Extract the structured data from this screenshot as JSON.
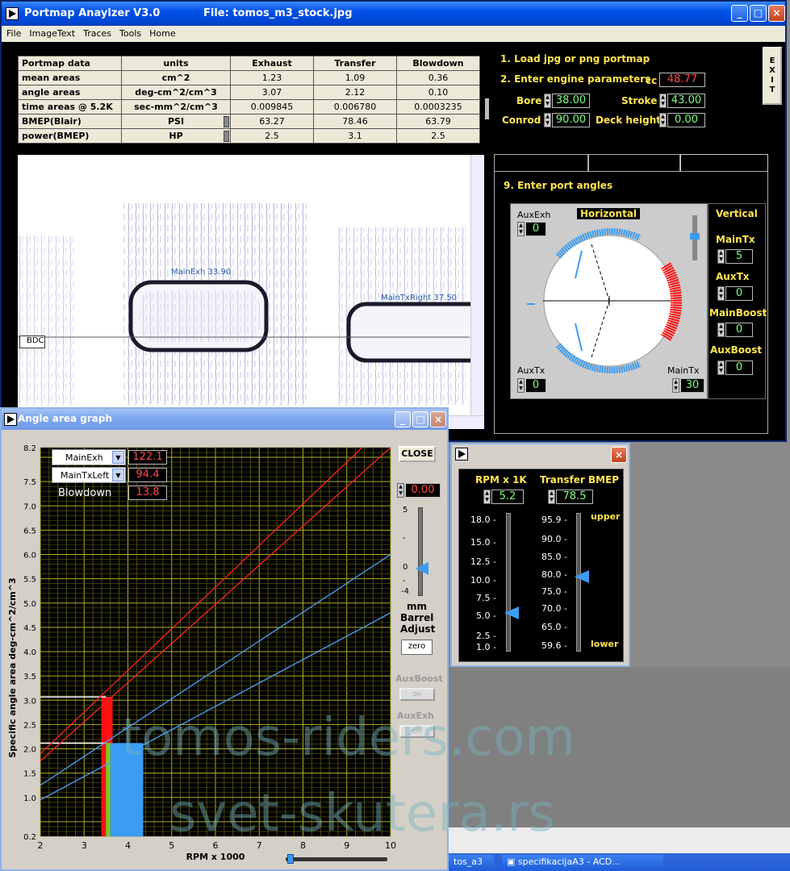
{
  "main_window": {
    "title": "Portmap Anaylzer V3.0",
    "file_label": "File: tomos_m3_stock.jpg",
    "menu": [
      "File",
      "ImageText",
      "Traces",
      "Tools",
      "Home"
    ],
    "exit_label": "EXIT"
  },
  "portmap_table": {
    "headers": [
      "Portmap data",
      "units",
      "Exhaust",
      "Transfer",
      "Blowdown"
    ],
    "rows": [
      {
        "label": "mean areas",
        "unit": "cm^2",
        "exhaust": "1.23",
        "transfer": "1.09",
        "blowdown": "0.36"
      },
      {
        "label": "angle areas",
        "unit": "deg-cm^2/cm^3",
        "exhaust": "3.07",
        "transfer": "2.12",
        "blowdown": "0.10"
      },
      {
        "label": "time areas @ 5.2K",
        "unit": "sec-mm^2/cm^3",
        "exhaust": "0.009845",
        "transfer": "0.006780",
        "blowdown": "0.0003235"
      },
      {
        "label": "BMEP(Blair)",
        "unit": "PSI",
        "exhaust": "63.27",
        "transfer": "78.46",
        "blowdown": "63.79"
      },
      {
        "label": "power(BMEP)",
        "unit": "HP",
        "exhaust": "2.5",
        "transfer": "3.1",
        "blowdown": "2.5"
      }
    ]
  },
  "portmap_image": {
    "labels": {
      "main_exh": "MainExh 33.90",
      "main_tx_right": "MainTxRight 37.50",
      "bdc": "BDC"
    }
  },
  "params": {
    "step1": "1. Load jpg or png portmap",
    "step2": "2. Enter engine parameters",
    "cc_label": "cc",
    "cc_value": "48.77",
    "bore_label": "Bore",
    "bore_value": "38.00",
    "stroke_label": "Stroke",
    "stroke_value": "43.00",
    "conrod_label": "Conrod",
    "conrod_value": "90.00",
    "deck_label": "Deck height",
    "deck_value": "0.00"
  },
  "port_angles": {
    "step9": "9. Enter port angles",
    "horizontal_label": "Horizontal",
    "vertical_label": "Vertical",
    "aux_exh_label": "AuxExh",
    "aux_exh_value": "0",
    "aux_tx_label": "AuxTx",
    "aux_tx_value": "0",
    "main_tx_label": "MainTx",
    "main_tx_value": "30",
    "v_main_tx_label": "MainTx",
    "v_main_tx_value": "5",
    "v_aux_tx_label": "AuxTx",
    "v_aux_tx_value": "0",
    "v_main_boost_label": "MainBoost",
    "v_main_boost_value": "0",
    "v_aux_boost_label": "AuxBoost",
    "v_aux_boost_value": "0"
  },
  "graph_window": {
    "title": "Angle area graph",
    "close_label": "CLOSE",
    "sel1_label": "MainExh",
    "sel1_value": "122.1",
    "sel2_label": "MainTxLeft",
    "sel2_value": "94.4",
    "blowdown_label": "Blowdown",
    "blowdown_value": "13.8",
    "barrel_value": "0.00",
    "barrel_ticks": [
      "5",
      "-",
      "0",
      "-",
      "-4"
    ],
    "barrel_label_1": "mm",
    "barrel_label_2": "Barrel",
    "barrel_label_3": "Adjust",
    "zero_label": "zero",
    "aux_boost_label": "AuxBoost",
    "aux_boost_btn": "on",
    "aux_exh_label": "AuxExh",
    "aux_exh_btn": "on"
  },
  "chart_data": {
    "type": "line",
    "xlabel": "RPM x 1000",
    "ylabel": "Specific angle area  deg-cm^2/cm^3",
    "xlim": [
      2,
      10
    ],
    "ylim": [
      0.2,
      8.2
    ],
    "x_ticks": [
      "2",
      "3",
      "4",
      "5",
      "6",
      "7",
      "8",
      "9",
      "10"
    ],
    "y_ticks": [
      "0.2",
      "1.0",
      "1.5",
      "2.0",
      "2.5",
      "3.0",
      "3.5",
      "4.0",
      "4.5",
      "5.0",
      "5.5",
      "6.0",
      "6.5",
      "7.0",
      "7.5",
      "8.2"
    ],
    "grid": true,
    "series": [
      {
        "color": "#ff2020",
        "points": [
          [
            2,
            1.9
          ],
          [
            9.35,
            8.2
          ]
        ]
      },
      {
        "color": "#ff2020",
        "points": [
          [
            2,
            1.75
          ],
          [
            10,
            8.2
          ]
        ]
      },
      {
        "color": "#4aa0ff",
        "points": [
          [
            2,
            1.25
          ],
          [
            10,
            6.0
          ]
        ]
      },
      {
        "color": "#4aa0ff",
        "points": [
          [
            2,
            0.95
          ],
          [
            10,
            4.8
          ]
        ]
      }
    ],
    "bars": [
      {
        "x0": 3.4,
        "x1": 3.65,
        "y": 3.07,
        "color": "#ff1010"
      },
      {
        "x0": 3.4,
        "x1": 3.5,
        "y": 2.12,
        "color": "#ff1010"
      },
      {
        "x0": 3.5,
        "x1": 3.6,
        "y": 2.12,
        "color": "#6cd22a"
      },
      {
        "x0": 3.6,
        "x1": 4.35,
        "y": 2.12,
        "color": "#3a9cf2"
      }
    ],
    "ref_lines": [
      3.07,
      2.12
    ]
  },
  "rpm_window": {
    "rpm_label": "RPM x 1K",
    "rpm_value": "5.2",
    "bmep_label": "Transfer BMEP",
    "bmep_value": "78.5",
    "rpm_ticks": [
      "18.0",
      "15.0",
      "12.5",
      "10.0",
      "7.5",
      "5.0",
      "2.5",
      "1.0"
    ],
    "bmep_ticks": [
      "95.9",
      "90.0",
      "85.0",
      "80.0",
      "75.0",
      "70.0",
      "65.0",
      "59.6"
    ],
    "upper_label": "upper",
    "lower_label": "lower"
  },
  "taskbar": {
    "item1": "tos_a3",
    "item2": "specifikacijaA3 - ACD..."
  },
  "watermark": {
    "line1": "tomos-riders.com",
    "line2": "svet-skutera.rs"
  },
  "colors": {
    "label_yellow": "#ffe650",
    "value_green": "#7dff7d",
    "value_red": "#ff4a4a",
    "exhaust_port": "#ff1010",
    "transfer_port": "#3a9cf2"
  }
}
